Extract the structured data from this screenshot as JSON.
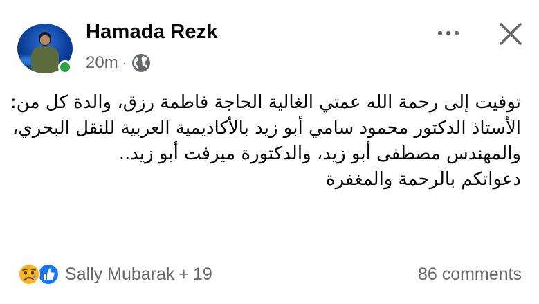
{
  "post": {
    "author": "Hamada Rezk",
    "time": "20m",
    "separator": "·",
    "privacy_icon": "globe-icon",
    "menu_icon": "more-horizontal-icon",
    "close_icon": "close-icon",
    "text": "توفيت إلى رحمة الله عمتي الغالية الحاجة فاطمة رزق، والدة كل من: الأستاذ الدكتور محمود سامي أبو زيد بالأكاديمية العربية للنقل البحري، والمهندس مصطفى أبو زيد، والدكتورة ميرفت أبو زيد..\nدعواتكم بالرحمة والمغفرة"
  },
  "reactions": {
    "icons": [
      "sad-reaction-icon",
      "like-reaction-icon"
    ],
    "name": "Sally Mubarak",
    "plus": "+",
    "others_count": "19"
  },
  "comments": {
    "label": "86 comments"
  },
  "colors": {
    "text": "#050505",
    "secondary": "#65676b",
    "online": "#31a24c",
    "like_blue": "#1877f2",
    "sad_yellow": "#f7b125"
  }
}
